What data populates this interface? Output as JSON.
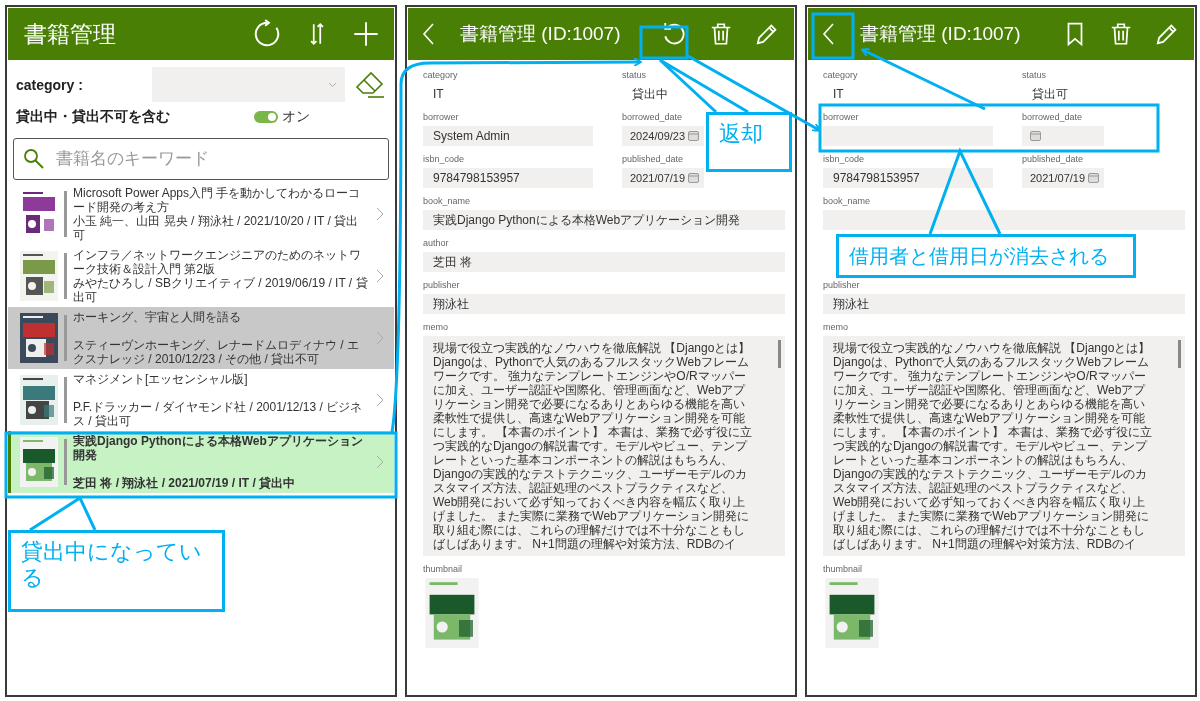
{
  "list_screen": {
    "title": "書籍管理",
    "actions": [
      {
        "kind": "refresh"
      },
      {
        "kind": "sort"
      },
      {
        "kind": "add"
      }
    ],
    "category_filter": {
      "label": "category :"
    },
    "include_unavailable": {
      "label": "貸出中・貸出不可を含む",
      "on": true,
      "state_text": "オン"
    },
    "search": {
      "placeholder": "書籍名のキーワード"
    },
    "books": [
      {
        "title": "Microsoft Power Apps入門 手を動かしてわかるローコード開発の考え方",
        "details": "小玉 純一、山田 晃央 / 翔泳社 / 2021/10/20 / IT / 貸出可",
        "selected": false,
        "disabled": false
      },
      {
        "title": "インフラ／ネットワークエンジニアのためのネットワーク技術＆設計入門 第2版",
        "details": "みやたひろし / SBクリエイティブ / 2019/06/19 / IT / 貸出可",
        "selected": false,
        "disabled": false
      },
      {
        "title": "ホーキング、宇宙と人間を語る",
        "details": "スティーヴンホーキング、レナードムロディナウ / エクスナレッジ / 2010/12/23 / その他 / 貸出不可",
        "selected": false,
        "disabled": true
      },
      {
        "title": "マネジメント[エッセンシャル版]",
        "details": "P.F.ドラッカー / ダイヤモンド社 / 2001/12/13 / ビジネス / 貸出可",
        "selected": false,
        "disabled": false
      },
      {
        "title": "実践Django Pythonによる本格Webアプリケーション開発",
        "details": "芝田 将 / 翔泳社 / 2021/07/19 / IT / 貸出中",
        "selected": true,
        "disabled": false
      }
    ]
  },
  "detail_screens": [
    {
      "title": "書籍管理 (ID:1007)",
      "actions": [
        {
          "kind": "return"
        },
        {
          "kind": "delete"
        },
        {
          "kind": "edit"
        }
      ],
      "fields": [
        {
          "kind": "text",
          "label": "category",
          "value": "IT"
        },
        {
          "kind": "text",
          "label": "status",
          "value": "貸出中"
        },
        {
          "kind": "input",
          "label": "borrower",
          "value": "System Admin"
        },
        {
          "kind": "date",
          "label": "borrowed_date",
          "value": "2024/09/23"
        },
        {
          "kind": "input",
          "label": "isbn_code",
          "value": "9784798153957"
        },
        {
          "kind": "date",
          "label": "published_date",
          "value": "2021/07/19"
        },
        {
          "kind": "wide",
          "label": "book_name",
          "value": "実践Django Pythonによる本格Webアプリケーション開発"
        },
        {
          "kind": "wide",
          "label": "author",
          "value": "芝田 将"
        },
        {
          "kind": "wide",
          "label": "publisher",
          "value": "翔泳社"
        },
        {
          "kind": "memo",
          "label": "memo",
          "value": "現場で役立つ実践的なノウハウを徹底解説 【Djangoとは】 Djangoは、Pythonで人気のあるフルスタックWebフレームワークです。 強力なテンプレートエンジンやO/Rマッパーに加え、ユーザー認証や国際化、管理画面など、Webアプリケーション開発で必要になるありとあらゆる機能を高い柔軟性で提供し、高速なWebアプリケーション開発を可能にします。 【本書のポイント】 本書は、業務で必ず役に立つ実践的なDjangoの解説書です。モデルやビュー、テンプレートといった基本コンポーネントの解説はもちろん、Djangoの実践的なテストテクニック、ユーザーモデルのカスタマイズ方法、認証処理のベストプラクティスなど、Web開発において必ず知っておくべき内容を幅広く取り上げました。 また実際に業務でWebアプリケーション開発に取り組む際には、これらの理解だけでは不十分なこともしばしばあります。 N+1問題の理解や対策方法、RDBのイ"
        },
        {
          "kind": "thumbnail",
          "label": "thumbnail"
        }
      ]
    },
    {
      "title": "書籍管理 (ID:1007)",
      "actions": [
        {
          "kind": "bookmark"
        },
        {
          "kind": "delete"
        },
        {
          "kind": "edit"
        }
      ],
      "fields": [
        {
          "kind": "text",
          "label": "category",
          "value": "IT"
        },
        {
          "kind": "text",
          "label": "status",
          "value": "貸出可"
        },
        {
          "kind": "input",
          "label": "borrower"
        },
        {
          "kind": "date",
          "label": "borrowed_date"
        },
        {
          "kind": "input",
          "label": "isbn_code",
          "value": "9784798153957"
        },
        {
          "kind": "date",
          "label": "published_date",
          "value": "2021/07/19"
        },
        {
          "kind": "wide",
          "label": "book_name"
        },
        {
          "kind": "wide"
        },
        {
          "kind": "wide",
          "label": "publisher",
          "value": "翔泳社"
        },
        {
          "kind": "memo",
          "label": "memo",
          "value": "現場で役立つ実践的なノウハウを徹底解説 【Djangoとは】 Djangoは、Pythonで人気のあるフルスタックWebフレームワークです。 強力なテンプレートエンジンやO/Rマッパーに加え、ユーザー認証や国際化、管理画面など、Webアプリケーション開発で必要になるありとあらゆる機能を高い柔軟性で提供し、高速なWebアプリケーション開発を可能にします。 【本書のポイント】 本書は、業務で必ず役に立つ実践的なDjangoの解説書です。モデルやビュー、テンプレートといった基本コンポーネントの解説はもちろん、Djangoの実践的なテストテクニック、ユーザーモデルのカスタマイズ方法、認証処理のベストプラクティスなど、Web開発において必ず知っておくべき内容を幅広く取り上げました。 また実際に業務でWebアプリケーション開発に取り組む際には、これらの理解だけでは不十分なこともしばしばあります。 N+1問題の理解や対策方法、RDBのイ"
        },
        {
          "kind": "thumbnail",
          "label": "thumbnail"
        }
      ]
    }
  ],
  "annotations": [
    {
      "text": "返却"
    },
    {
      "text": "借用者と借用日が消去される"
    },
    {
      "text": "貸出中になっている"
    }
  ]
}
